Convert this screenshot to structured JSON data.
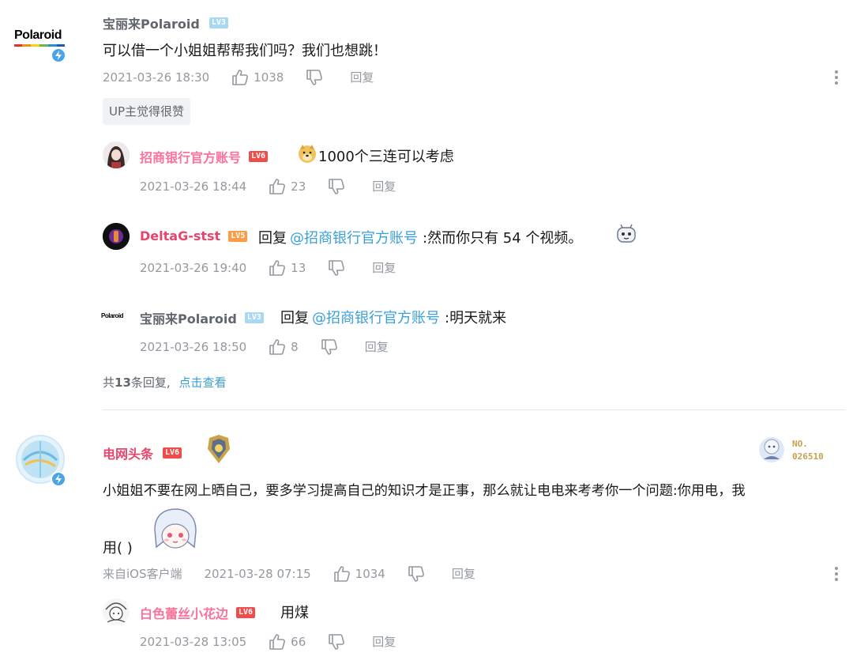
{
  "comment1": {
    "user": "宝丽来Polaroid",
    "level": "LV3",
    "avatar_text": "Polaroid",
    "text": "可以借一个小姐姐帮帮我们吗？我们也想跳！",
    "time": "2021-03-26 18:30",
    "likes": "1038",
    "reply_label": "回复",
    "up_badge": "UP主觉得很赞",
    "replies": [
      {
        "user": "招商银行官方账号",
        "level": "LV6",
        "text": "1000个三连可以考虑",
        "time": "2021-03-26 18:44",
        "likes": "23",
        "reply_label": "回复"
      },
      {
        "user": "DeltaG-stst",
        "level": "LV5",
        "reply_prefix": "回复",
        "mention": "@招商银行官方账号",
        "text": ":然而你只有 54 个视频。",
        "time": "2021-03-26 19:40",
        "likes": "13",
        "reply_label": "回复"
      },
      {
        "user": "宝丽来Polaroid",
        "level": "LV3",
        "avatar_text": "Polaroid",
        "reply_prefix": "回复",
        "mention": "@招商银行官方账号",
        "text": ":明天就来",
        "time": "2021-03-26 18:50",
        "likes": "8",
        "reply_label": "回复"
      }
    ],
    "more_prefix": "共",
    "more_count": "13",
    "more_suffix": "条回复,",
    "more_link": "点击查看"
  },
  "comment2": {
    "user": "电网头条",
    "level": "LV6",
    "fan_badge_no": "NO.",
    "fan_badge_num": "026510",
    "text_line1": "小姐姐不要在网上晒自己，要多学习提高自己的知识才是正事，那么就让电电来考考你一个问题:你用电，我",
    "text_line2": "用(  )",
    "source": "来自iOS客户端",
    "time": "2021-03-28 07:15",
    "likes": "1034",
    "reply_label": "回复",
    "replies": [
      {
        "user": "白色蕾丝小花边",
        "level": "LV6",
        "text": "用煤",
        "time": "2021-03-28 13:05",
        "likes": "66",
        "reply_label": "回复"
      }
    ]
  },
  "icons": [
    "thumbs-up-icon",
    "thumbs-down-icon",
    "more-icon",
    "verified-icon"
  ],
  "colors": {
    "link": "#3aa0d8",
    "pink_name": "#fb7299",
    "meta": "#9499a0",
    "lv6": "#f04c49",
    "lv5": "#ff9b45",
    "lv3": "#a9d8f2"
  }
}
